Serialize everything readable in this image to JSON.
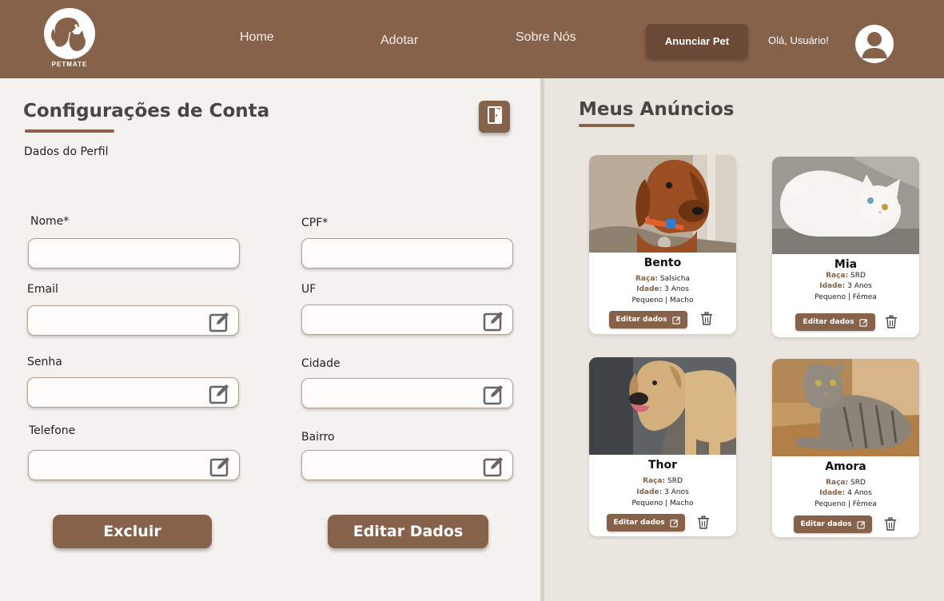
{
  "header": {
    "logo_text": "PETMATE",
    "nav": [
      "Home",
      "Adotar",
      "Sobre Nós"
    ],
    "announce_label": "Anunciar Pet",
    "greeting": "Olá, Usuário!"
  },
  "account": {
    "title": "Configurações de Conta",
    "subtitle": "Dados do Perfil",
    "fields": {
      "nome": {
        "label": "Nome*",
        "value": ""
      },
      "cpf": {
        "label": "CPF*",
        "value": ""
      },
      "email": {
        "label": "Email",
        "value": ""
      },
      "uf": {
        "label": "UF",
        "value": ""
      },
      "senha": {
        "label": "Senha",
        "value": ""
      },
      "cidade": {
        "label": "Cidade",
        "value": ""
      },
      "telefone": {
        "label": "Telefone",
        "value": ""
      },
      "bairro": {
        "label": "Bairro",
        "value": ""
      }
    },
    "delete_label": "Excluir",
    "edit_label": "Editar Dados"
  },
  "listings": {
    "title": "Meus Anúncios",
    "breed_label": "Raça:",
    "age_label": "Idade:",
    "edit_label": "Editar dados",
    "pets": [
      {
        "name": "Bento",
        "breed": "Salsicha",
        "age": "3 Anos",
        "info": "Pequeno | Macho",
        "photo": "dachshund-photo"
      },
      {
        "name": "Mia",
        "breed": "SRD",
        "age": "3 Anos",
        "info": "Pequeno | Fêmea",
        "photo": "white-cat-photo"
      },
      {
        "name": "Thor",
        "breed": "SRD",
        "age": "3 Anos",
        "info": "Pequeno | Macho",
        "photo": "tan-dog-photo"
      },
      {
        "name": "Amora",
        "breed": "SRD",
        "age": "4 Anos",
        "info": "Pequeno | Fêmea",
        "photo": "tabby-cat-photo"
      }
    ]
  },
  "colors": {
    "brand": "#86624b",
    "brand_dark": "#6a4a37",
    "left_bg": "#f4f2ef",
    "right_bg": "#ebe5df"
  }
}
